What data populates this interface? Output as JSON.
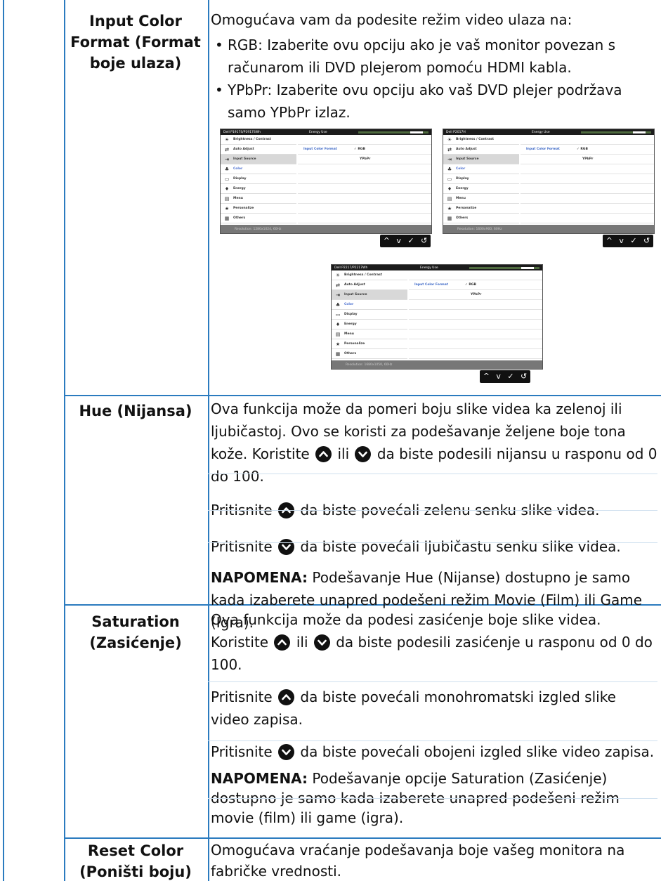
{
  "rows": {
    "input_color_format": {
      "head": [
        "Input Color",
        "Format (Format",
        "boje ulaza)"
      ],
      "intro": "Omogućava vam da podesite režim video ulaza na:",
      "bullets": [
        "RGB: Izaberite ovu opciju ako je vaš monitor povezan s računarom ili DVD plejerom pomoću HDMI kabla.",
        "YPbPr: Izaberite ovu opciju ako vaš DVD plejer podržava samo YPbPr izlaz."
      ]
    },
    "hue": {
      "head": "Hue (Nijansa)",
      "p1a": "Ova funkcija može da pomeri boju slike videa ka zelenoj ili ljubičastoj. Ovo se koristi za podešavanje željene boje tona kože. Koristite",
      "p1b": "ili",
      "p1c": "da biste podesili nijansu u rasponu od 0 do 100.",
      "p2a": "Pritisnite",
      "p2b": "da biste povećali zelenu senku slike videa.",
      "p3a": "Pritisnite",
      "p3b": "da biste povećali ljubičastu senku slike videa.",
      "note_label": "NAPOMENA:",
      "note": "Podešavanje Hue (Nijanse) dostupno je samo kada izaberete unapred podešeni režim Movie (Film) ili Game (Igra)."
    },
    "saturation": {
      "head": [
        "Saturation",
        "(Zasićenje)"
      ],
      "p1": "Ova funkcija može da podesi zasićenje boje slike videa.",
      "p2a": "Koristite",
      "p2b": "ili",
      "p2c": "da biste podesili zasićenje u rasponu od 0 do 100.",
      "p3a": "Pritisnite",
      "p3b": "da biste povećali monohromatski izgled slike video zapisa.",
      "p4a": "Pritisnite",
      "p4b": "da biste povećali obojeni izgled slike video zapisa.",
      "note_label": "NAPOMENA:",
      "note": "Podešavanje opcije Saturation (Zasićenje) dostupno je samo kada izaberete unapred podešeni režim movie (film) ili game (igra)."
    },
    "reset_color": {
      "head": [
        "Reset Color",
        "(Poništi boju)"
      ],
      "text": "Omogućava vraćanje podešavanja boje vašeg monitora na fabričke vrednosti."
    }
  },
  "osd": {
    "models": [
      "Dell P1917S/P1917SWh",
      "Dell P2017H",
      "Dell P2217/P2217Wh"
    ],
    "energy_use": "Energy Use",
    "menu": [
      "Brightness / Contrast",
      "Auto Adjust",
      "Input Source",
      "Color",
      "Display",
      "Energy",
      "Menu",
      "Personalize",
      "Others"
    ],
    "menu_icons": [
      "sun-icon",
      "auto-adjust-icon",
      "input-source-icon",
      "color-icon",
      "display-icon",
      "energy-icon",
      "menu-icon",
      "star-icon",
      "others-icon"
    ],
    "input_color_format_label": "Input Color Format",
    "rgb": "RGB",
    "ypbpr": "YPbPr",
    "resolutions": [
      "Resolution: 1280x1024, 60Hz",
      "Resolution: 1600x900, 60Hz",
      "Resolution: 1680x1050, 60Hz"
    ],
    "nav_glyphs": [
      "^",
      "v",
      "✓",
      "↺"
    ]
  }
}
